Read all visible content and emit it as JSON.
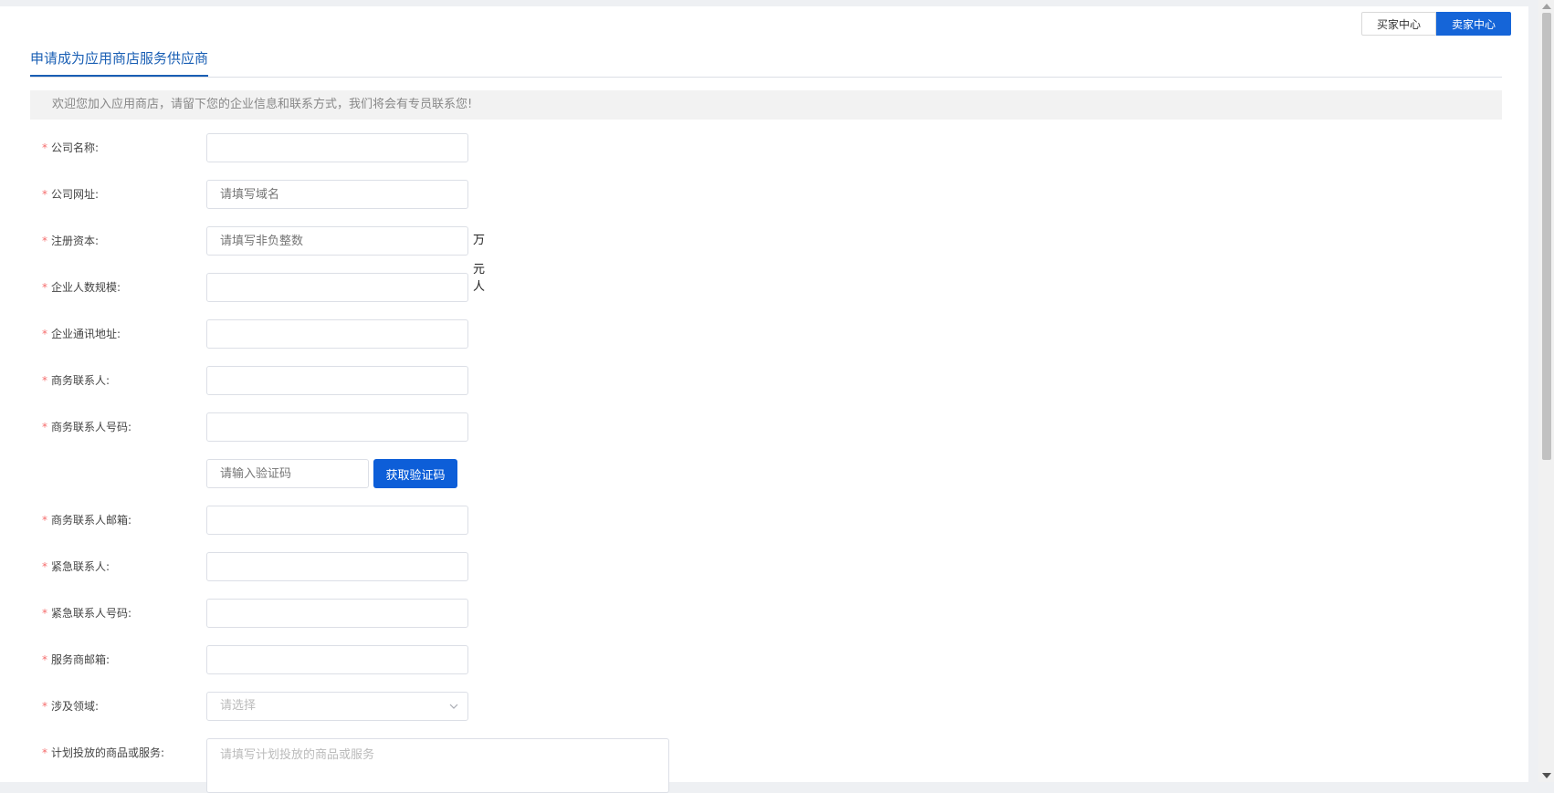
{
  "header": {
    "buyer_tab": "买家中心",
    "seller_tab": "卖家中心"
  },
  "title": "申请成为应用商店服务供应商",
  "notice": "欢迎您加入应用商店，请留下您的企业信息和联系方式，我们将会有专员联系您!",
  "required_mark": "*",
  "form": {
    "company_name": {
      "label": "公司名称:",
      "value": "",
      "placeholder": ""
    },
    "company_site": {
      "label": "公司网址:",
      "value": "",
      "placeholder": "请填写域名"
    },
    "registered_capital": {
      "label": "注册资本:",
      "value": "",
      "placeholder": "请填写非负整数",
      "suffix": "万元"
    },
    "staff_size": {
      "label": "企业人数规模:",
      "value": "",
      "placeholder": "",
      "suffix": "人"
    },
    "address": {
      "label": "企业通讯地址:",
      "value": "",
      "placeholder": ""
    },
    "biz_contact": {
      "label": "商务联系人:",
      "value": "",
      "placeholder": ""
    },
    "biz_phone": {
      "label": "商务联系人号码:",
      "value": "",
      "placeholder": ""
    },
    "verify_code": {
      "placeholder": "请输入验证码",
      "button": "获取验证码"
    },
    "biz_email": {
      "label": "商务联系人邮箱:",
      "value": "",
      "placeholder": ""
    },
    "emergency_contact": {
      "label": "紧急联系人:",
      "value": "",
      "placeholder": ""
    },
    "emergency_phone": {
      "label": "紧急联系人号码:",
      "value": "",
      "placeholder": ""
    },
    "provider_email": {
      "label": "服务商邮箱:",
      "value": "",
      "placeholder": ""
    },
    "domain": {
      "label": "涉及领域:",
      "placeholder": "请选择"
    },
    "products": {
      "label": "计划投放的商品或服务:",
      "placeholder": "请填写计划投放的商品或服务"
    }
  },
  "colors": {
    "accent": "#1565d8",
    "required": "#f56c6c",
    "title": "#1a5fb4"
  }
}
